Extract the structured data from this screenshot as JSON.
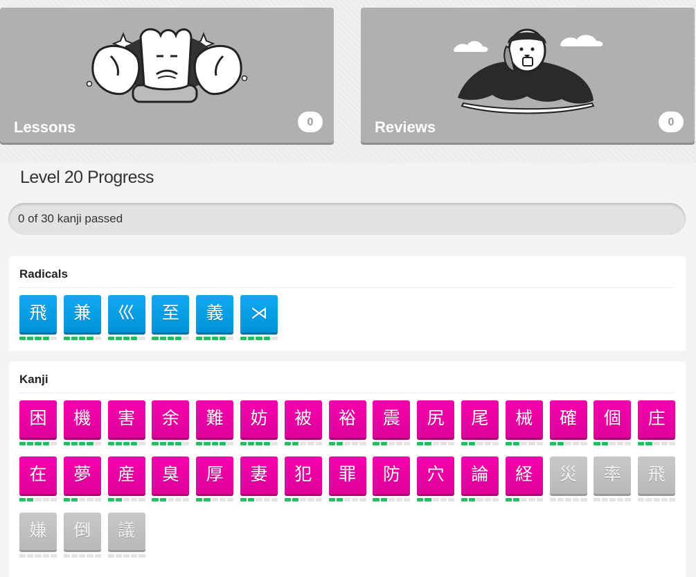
{
  "colors": {
    "radical": "#00aaff",
    "kanji": "#ff00aa",
    "locked": "#c0c0c0",
    "srs_progress": "#20c060",
    "card": "#b0b0b0"
  },
  "cards": {
    "lessons": {
      "label": "Lessons",
      "count": "0"
    },
    "reviews": {
      "label": "Reviews",
      "count": "0"
    }
  },
  "level": {
    "title": "Level 20 Progress",
    "progress_text": "0 of 30 kanji passed",
    "progress_fraction": 0
  },
  "radicals": {
    "title": "Radicals",
    "items": [
      {
        "char": "飛",
        "srs": 4,
        "locked": false
      },
      {
        "char": "兼",
        "srs": 4,
        "locked": false
      },
      {
        "char": "巛",
        "srs": 4,
        "locked": false
      },
      {
        "char": "至",
        "srs": 4,
        "locked": false
      },
      {
        "char": "義",
        "srs": 4,
        "locked": false
      },
      {
        "char": "⋊",
        "srs": 4,
        "locked": false
      }
    ]
  },
  "kanji": {
    "title": "Kanji",
    "items": [
      {
        "char": "困",
        "srs": 4,
        "locked": false
      },
      {
        "char": "機",
        "srs": 4,
        "locked": false
      },
      {
        "char": "害",
        "srs": 4,
        "locked": false
      },
      {
        "char": "余",
        "srs": 4,
        "locked": false
      },
      {
        "char": "難",
        "srs": 4,
        "locked": false
      },
      {
        "char": "妨",
        "srs": 4,
        "locked": false
      },
      {
        "char": "被",
        "srs": 2,
        "locked": false
      },
      {
        "char": "裕",
        "srs": 2,
        "locked": false
      },
      {
        "char": "震",
        "srs": 2,
        "locked": false
      },
      {
        "char": "尻",
        "srs": 2,
        "locked": false
      },
      {
        "char": "尾",
        "srs": 2,
        "locked": false
      },
      {
        "char": "械",
        "srs": 2,
        "locked": false
      },
      {
        "char": "確",
        "srs": 2,
        "locked": false
      },
      {
        "char": "個",
        "srs": 2,
        "locked": false
      },
      {
        "char": "庄",
        "srs": 2,
        "locked": false
      },
      {
        "char": "在",
        "srs": 2,
        "locked": false
      },
      {
        "char": "夢",
        "srs": 2,
        "locked": false
      },
      {
        "char": "産",
        "srs": 2,
        "locked": false
      },
      {
        "char": "臭",
        "srs": 2,
        "locked": false
      },
      {
        "char": "厚",
        "srs": 2,
        "locked": false
      },
      {
        "char": "妻",
        "srs": 2,
        "locked": false
      },
      {
        "char": "犯",
        "srs": 2,
        "locked": false
      },
      {
        "char": "罪",
        "srs": 2,
        "locked": false
      },
      {
        "char": "防",
        "srs": 2,
        "locked": false
      },
      {
        "char": "穴",
        "srs": 2,
        "locked": false
      },
      {
        "char": "論",
        "srs": 2,
        "locked": false
      },
      {
        "char": "経",
        "srs": 2,
        "locked": false
      },
      {
        "char": "災",
        "srs": 0,
        "locked": true
      },
      {
        "char": "率",
        "srs": 0,
        "locked": true
      },
      {
        "char": "飛",
        "srs": 0,
        "locked": true
      },
      {
        "char": "嫌",
        "srs": 0,
        "locked": true
      },
      {
        "char": "倒",
        "srs": 0,
        "locked": true
      },
      {
        "char": "議",
        "srs": 0,
        "locked": true
      }
    ]
  }
}
